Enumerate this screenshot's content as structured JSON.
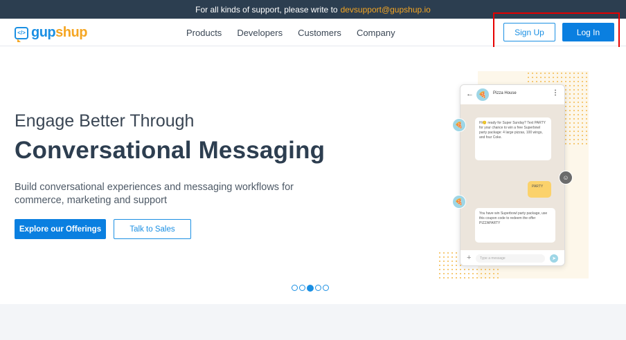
{
  "topbar": {
    "text": "For all kinds of support, please write to",
    "email": "devsupport@gupshup.io"
  },
  "logo": {
    "part1": "gup",
    "part2": "shup",
    "icon": "chat-code-icon"
  },
  "nav": {
    "items": [
      {
        "label": "Products"
      },
      {
        "label": "Developers"
      },
      {
        "label": "Customers"
      },
      {
        "label": "Company"
      }
    ],
    "signup_label": "Sign Up",
    "login_label": "Log In"
  },
  "hero": {
    "subtitle": "Engage Better Through",
    "title": "Conversational Messaging",
    "description": "Build conversational experiences and messaging workflows for commerce, marketing and support",
    "cta_primary": "Explore our Offerings",
    "cta_secondary": "Talk to Sales"
  },
  "carousel": {
    "slide_count": 5,
    "active_index": 2
  },
  "phone": {
    "contact_name": "Pizza House",
    "msg1": "Hi🙂 ready for Super Sunday? Text PARTY for your chance to win a free Superbowl party package: 4 large pizzas, 100 wings, and four Coke.",
    "msg2": "PARTY",
    "msg3": "You have win Superbowl party package, use this coupon code to redeem the offer PIZZAPARTY",
    "input_placeholder": "Type a message"
  },
  "colors": {
    "brand_blue": "#1a8fe3",
    "brand_orange": "#f5a623",
    "topbar_bg": "#2c3e50",
    "highlight": "#e60000"
  }
}
